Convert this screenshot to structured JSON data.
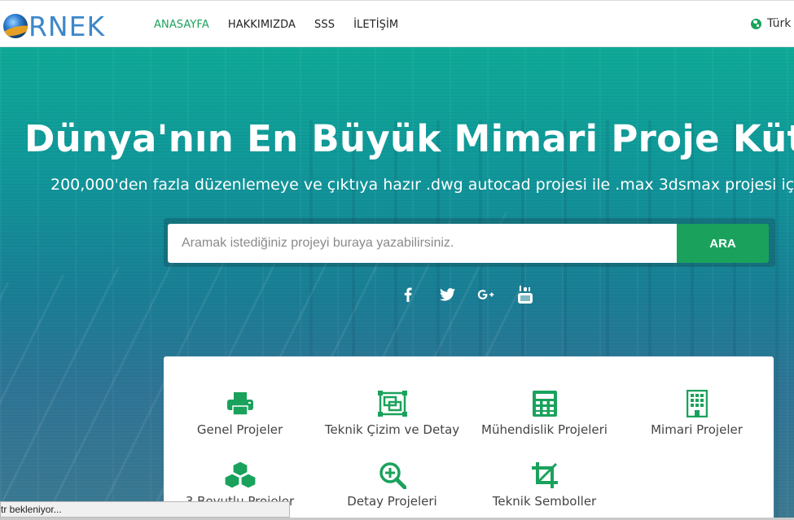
{
  "header": {
    "logo_text": "RNEK",
    "nav": [
      {
        "label": "ANASAYFA",
        "active": true
      },
      {
        "label": "HAKKIMIZDA",
        "active": false
      },
      {
        "label": "SSS",
        "active": false
      },
      {
        "label": "İLETİŞİM",
        "active": false
      }
    ],
    "language": "Türk"
  },
  "hero": {
    "title": "Dünya'nın En Büyük Mimari Proje Kütüph",
    "subtitle": "200,000'den fazla düzenlemeye ve çıktıya hazır .dwg autocad projesi ile .max 3dsmax projesi iç",
    "search": {
      "placeholder": "Aramak istediğiniz projeyi buraya yazabilirsiniz.",
      "button": "ARA"
    },
    "socials": [
      "facebook-icon",
      "twitter-icon",
      "google-plus-icon",
      "youtube-icon"
    ]
  },
  "categories": [
    {
      "label": "Genel Projeler",
      "icon": "printer-icon"
    },
    {
      "label": "Teknik Çizim ve Detay",
      "icon": "drawing-frame-icon"
    },
    {
      "label": "Mühendislik Projeleri",
      "icon": "calculator-icon"
    },
    {
      "label": "Mimari Projeler",
      "icon": "building-icon"
    },
    {
      "label": "3 Boyutlu Projeler",
      "icon": "cubes-icon"
    },
    {
      "label": "Detay Projeleri",
      "icon": "zoom-in-icon"
    },
    {
      "label": "Teknik Semboller",
      "icon": "crop-icon"
    }
  ],
  "status_bar": "tr bekleniyor...",
  "colors": {
    "accent": "#1aa25c",
    "logo": "#3d87c9",
    "hero_top": "#0faa98",
    "hero_bottom": "#3d7a92"
  }
}
